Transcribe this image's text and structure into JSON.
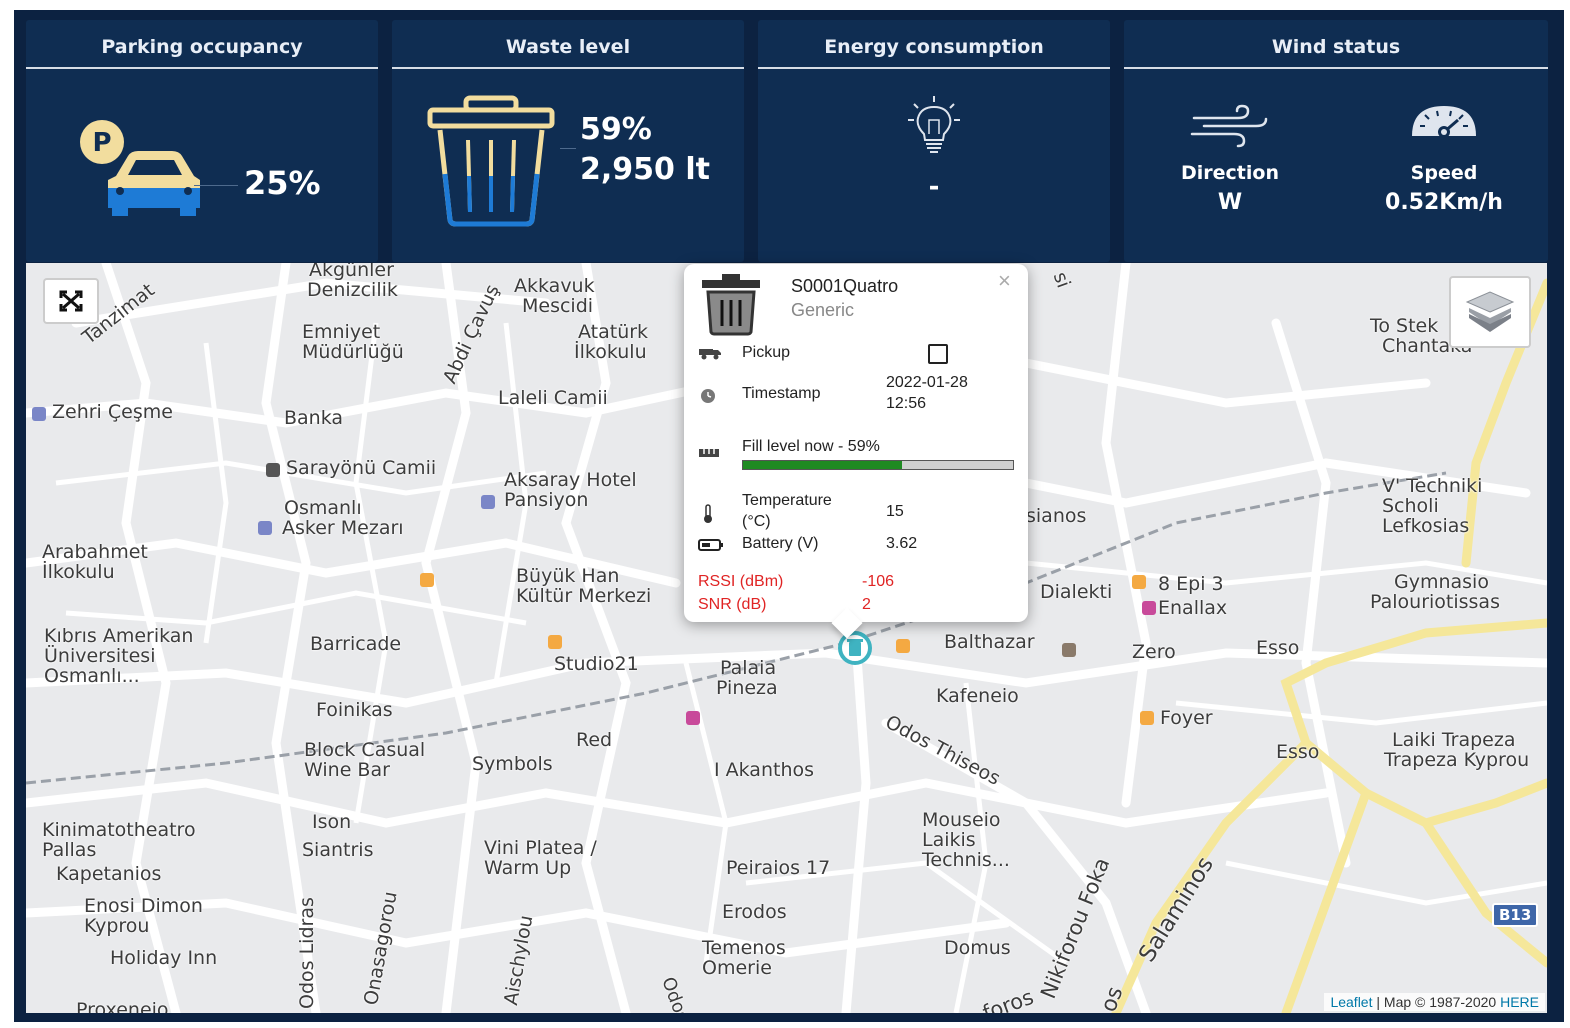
{
  "cards": {
    "parking": {
      "title": "Parking occupancy",
      "value": "25%"
    },
    "waste": {
      "title": "Waste level",
      "percent": "59%",
      "liters": "2,950 lt"
    },
    "energy": {
      "title": "Energy consumption",
      "value": "-"
    },
    "wind": {
      "title": "Wind status",
      "direction_label": "Direction",
      "direction_value": "W",
      "speed_label": "Speed",
      "speed_value": "0.52Km/h"
    }
  },
  "popup": {
    "device_name": "S0001Quatro",
    "device_type": "Generic",
    "close": "×",
    "pickup_label": "Pickup",
    "timestamp_label": "Timestamp",
    "timestamp_date": "2022-01-28",
    "timestamp_time": "12:56",
    "fill_label": "Fill level now - 59%",
    "fill_fraction": 0.59,
    "temperature_label": "Temperature",
    "temperature_unit": "(°C)",
    "temperature_value": "15",
    "battery_label": "Battery (V)",
    "battery_value": "3.62",
    "rssi_label": "RSSI (dBm)",
    "rssi_value": "-106",
    "snr_label": "SNR (dB)",
    "snr_value": "2"
  },
  "map": {
    "attribution_leaflet": "Leaflet",
    "attribution_text": " | Map © 1987-2020 ",
    "attribution_here": "HERE",
    "road_badge": "B13",
    "labels": [
      "Akgünler",
      "Denizcilik",
      "Akkavuk",
      "Mescidi",
      "Tanzimat",
      "Emniyet",
      "Müdürlüğü",
      "Atatürk",
      "İlkokulu",
      "Abdi Çavuş",
      "Zehri Çeşme",
      "Laleli Camii",
      "Banka",
      "Sarayönü Camii",
      "Aksaray Hotel",
      "Pansiyon",
      "Osmanlı",
      "Asker Mezarı",
      "Arabahmet",
      "İlkokulu",
      "Büyük Han",
      "Kültür Merkezi",
      "Kıbrıs Amerikan",
      "Üniversitesi",
      "Osmanlı...",
      "Barricade",
      "Studio21",
      "Palaia",
      "Pineza",
      "Foinikas",
      "Block Casual",
      "Wine Bar",
      "Symbols",
      "Red",
      "I Akanthos",
      "Kinimatotheatro",
      "Pallas",
      "Kapetanios",
      "Ison",
      "Siantris",
      "Vini Platea /",
      "Warm Up",
      "Peiraios 17",
      "Enosi Dimon",
      "Kyprou",
      "Holiday Inn",
      "Erodos",
      "Temenos",
      "Omerie",
      "Proxeneio",
      "Odos Lidras",
      "Onasagorou",
      "Aischylou",
      "To Stek",
      "Chantaka",
      "V' Techniki",
      "Scholi",
      "Lefkosias",
      "sianos",
      "Dialekti",
      "8 Epi 3",
      "Enallax",
      "Gymnasio",
      "Palouriotissas",
      "Balthazar",
      "Zero",
      "Esso",
      "Kafeneio",
      "Foyer",
      "Odos Thiseos",
      "Esso",
      "Laiki Trapeza",
      "Trapeza Kyprou",
      "Mouseio",
      "Laikis",
      "Technis...",
      "Nikiforou Foka",
      "Salaminos",
      "Domus",
      "foros",
      "os",
      "Odos",
      "si"
    ]
  }
}
